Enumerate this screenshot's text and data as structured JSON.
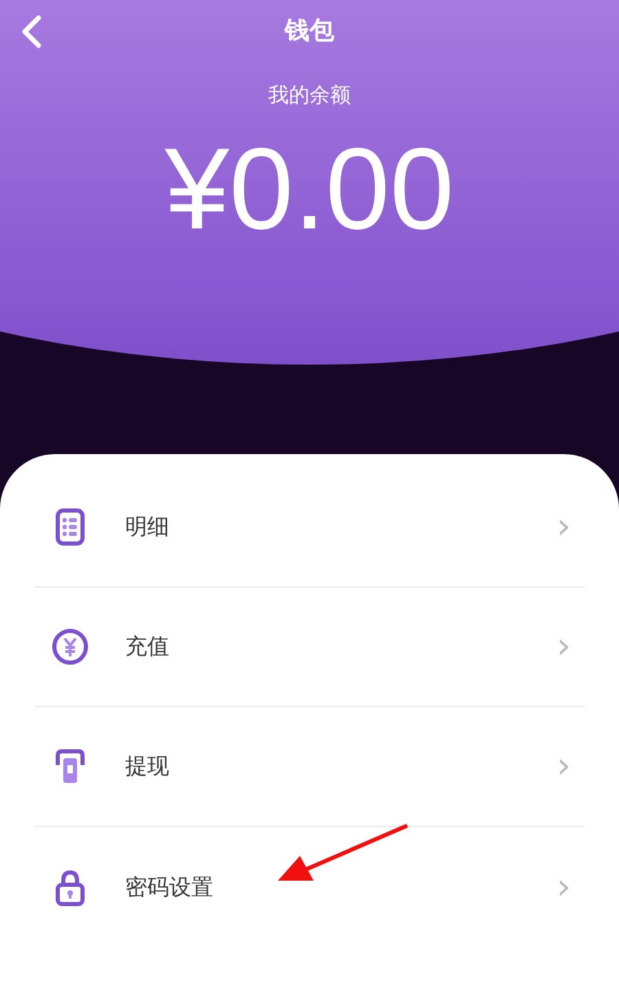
{
  "header": {
    "title": "钱包",
    "balance_label": "我的余额",
    "balance": "¥0.00"
  },
  "menu": [
    {
      "kind": "list",
      "label": "明细",
      "chevron": "›"
    },
    {
      "kind": "coin",
      "label": "充值",
      "chevron": "›"
    },
    {
      "kind": "atm",
      "label": "提现",
      "chevron": "›"
    },
    {
      "kind": "lock",
      "label": "密码设置",
      "chevron": "›"
    }
  ]
}
